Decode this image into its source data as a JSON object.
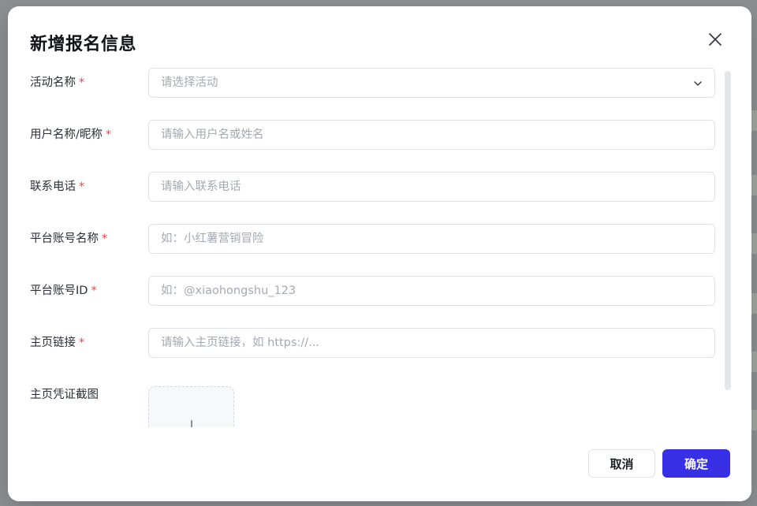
{
  "modal": {
    "title": "新增报名信息",
    "close_icon": "close-icon"
  },
  "form": {
    "activity": {
      "label": "活动名称",
      "required_mark": "*",
      "placeholder": "请选择活动",
      "icon": "chevron-down-icon"
    },
    "user_name": {
      "label": "用户名称/昵称",
      "required_mark": "*",
      "placeholder": "请输入用户名或姓名"
    },
    "phone": {
      "label": "联系电话",
      "required_mark": "*",
      "placeholder": "请输入联系电话"
    },
    "platform_account_name": {
      "label": "平台账号名称",
      "required_mark": "*",
      "placeholder": "如：小红薯营销冒险"
    },
    "platform_account_id": {
      "label": "平台账号ID",
      "required_mark": "*",
      "placeholder": "如：@xiaohongshu_123"
    },
    "homepage_link": {
      "label": "主页链接",
      "required_mark": "*",
      "placeholder": "请输入主页链接，如 https://..."
    },
    "homepage_screenshot": {
      "label": "主页凭证截图",
      "icon": "plus-icon"
    }
  },
  "footer": {
    "cancel_label": "取消",
    "confirm_label": "确定"
  },
  "colors": {
    "primary": "#3730e6",
    "required": "#e5484d",
    "overlay": "#8d8f93"
  }
}
